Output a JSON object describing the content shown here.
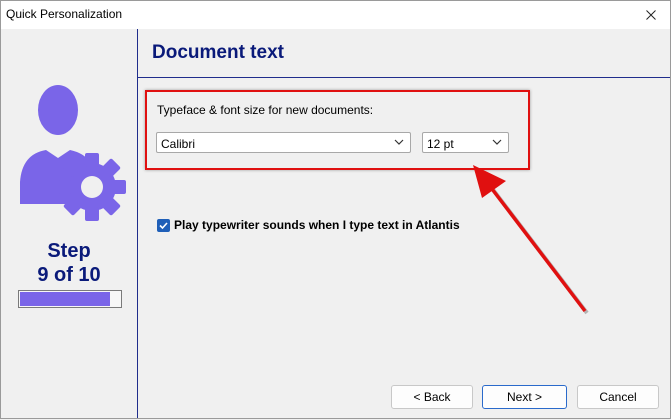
{
  "window": {
    "title": "Quick Personalization",
    "close_icon": "close-icon"
  },
  "sidebar": {
    "icon": "user-gear-icon",
    "step_line1": "Step",
    "step_line2": "9 of 10",
    "progress_fraction": 0.9,
    "accent_color": "#7a65e8",
    "text_color": "#0a1a7a"
  },
  "page": {
    "title": "Document text",
    "font_label": "Typeface & font size for new documents:",
    "font_select": {
      "value": "Calibri"
    },
    "size_select": {
      "value": "12 pt"
    },
    "checkbox": {
      "checked": true,
      "label": "Play typewriter sounds when I type text in Atlantis"
    },
    "highlight_color": "#e01010"
  },
  "buttons": {
    "back": "< Back",
    "next": "Next >",
    "cancel": "Cancel"
  }
}
